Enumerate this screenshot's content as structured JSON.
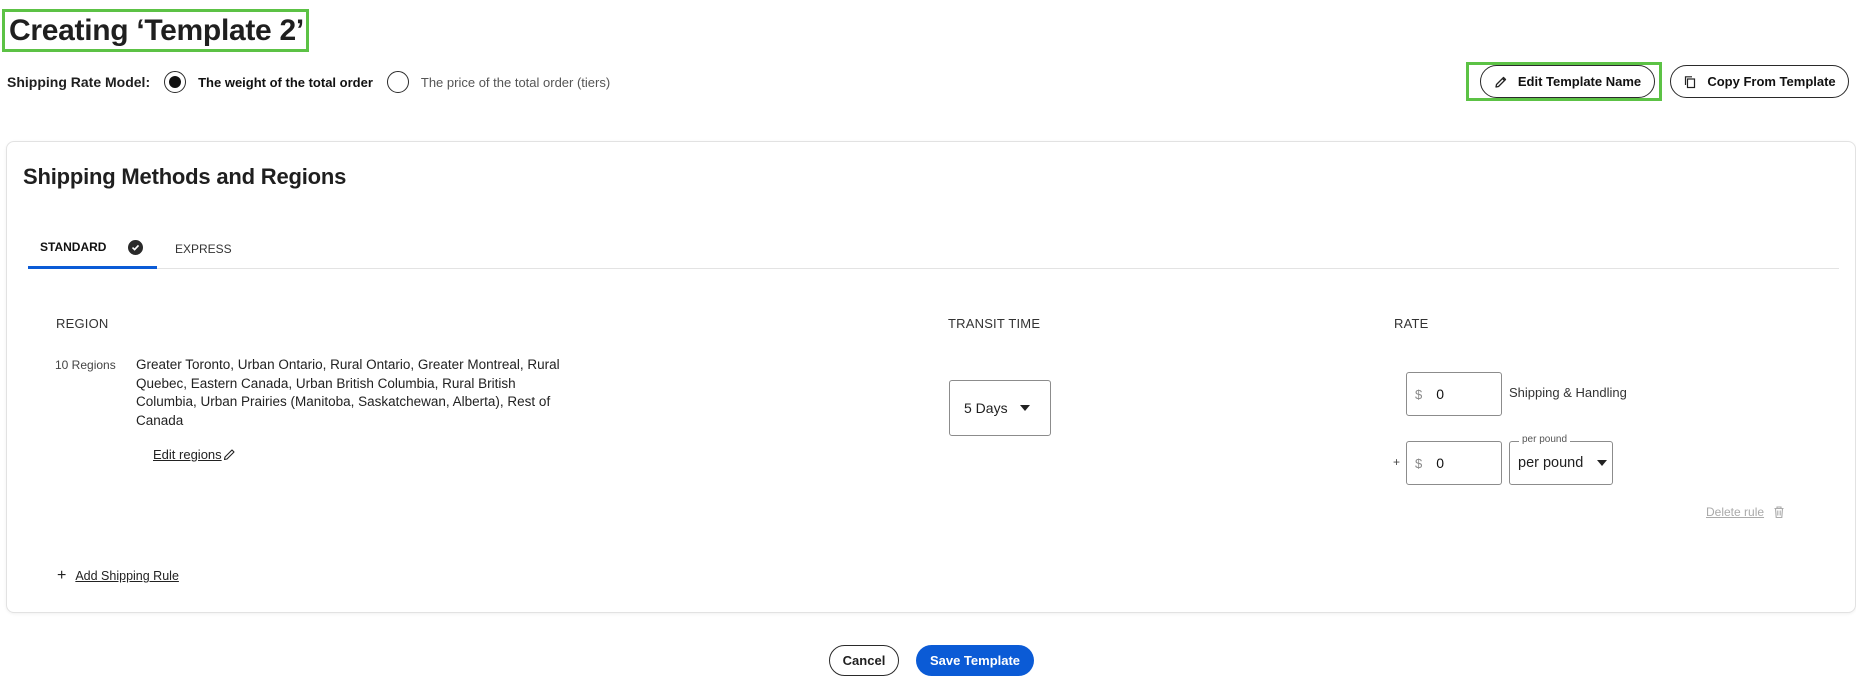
{
  "header": {
    "title": "Creating ‘Template 2’",
    "edit_name_label": "Edit Template Name",
    "copy_label": "Copy From Template"
  },
  "rate_model": {
    "label": "Shipping Rate Model:",
    "options": [
      {
        "label": "The weight of the total order",
        "selected": true
      },
      {
        "label": "The price of the total order (tiers)",
        "selected": false
      }
    ]
  },
  "section": {
    "title": "Shipping Methods and Regions",
    "tabs": [
      {
        "label": "STANDARD",
        "active": true,
        "completed": true
      },
      {
        "label": "EXPRESS",
        "active": false,
        "completed": false
      }
    ],
    "columns": {
      "region": "REGION",
      "transit": "TRANSIT TIME",
      "rate": "RATE"
    },
    "rule": {
      "region_count": "10 Regions",
      "regions": "Greater Toronto, Urban Ontario, Rural Ontario, Greater Montreal, Rural Quebec, Eastern Canada, Urban British Columbia, Rural British Columbia, Urban Prairies (Manitoba, Saskatchewan, Alberta), Rest of Canada",
      "edit_regions_label": "Edit regions",
      "transit_time": "5 Days",
      "currency_symbol": "$",
      "base_rate": "0",
      "base_rate_label": "Shipping & Handling",
      "plus": "+",
      "per_unit_rate": "0",
      "unit_floating_label": "per pound",
      "unit_value": "per pound",
      "delete_label": "Delete rule"
    },
    "add_rule_label": "Add Shipping Rule"
  },
  "footer": {
    "cancel_label": "Cancel",
    "save_label": "Save Template"
  },
  "colors": {
    "accent": "#0b5bd6",
    "highlight_border": "#5cc245"
  }
}
